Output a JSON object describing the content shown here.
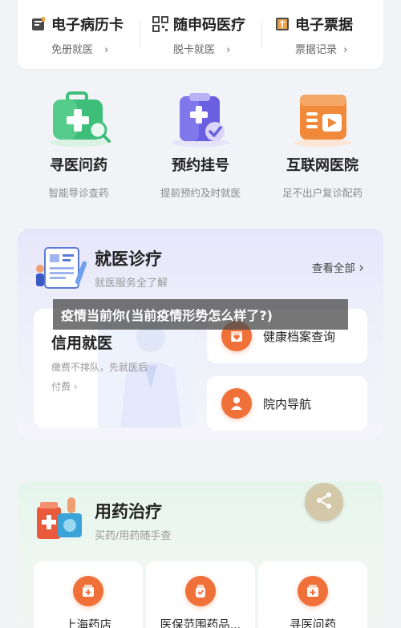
{
  "top_services": [
    {
      "title": "电子病历卡",
      "sub": "免册就医",
      "arrow": "›",
      "icon": "card-icon"
    },
    {
      "title": "随申码医疗",
      "sub": "脱卡就医",
      "arrow": "›",
      "icon": "qr-code-icon"
    },
    {
      "title": "电子票据",
      "sub": "票据记录",
      "arrow": "›",
      "icon": "receipt-icon"
    }
  ],
  "quick_services": [
    {
      "title": "寻医问药",
      "sub": "智能导诊查药",
      "icon": "medical-kit-search-icon"
    },
    {
      "title": "预约挂号",
      "sub": "提前预约及时就医",
      "icon": "appointment-clipboard-icon"
    },
    {
      "title": "互联网医院",
      "sub": "足不出户复诊配药",
      "icon": "online-hospital-icon"
    }
  ],
  "medical_panel": {
    "title": "就医诊疗",
    "subtitle": "就医服务全了解",
    "more": "查看全部",
    "more_arrow": "›",
    "credit_card": {
      "title": "信用就医",
      "desc": "缴费不排队，先就医后",
      "pay": "付费 ›"
    },
    "items": [
      {
        "label": "健康档案查询",
        "icon": "health-record-icon"
      },
      {
        "label": "院内导航",
        "icon": "person-navigation-icon"
      }
    ]
  },
  "banner": "疫情当前你(当前疫情形势怎么样了?)",
  "medicine_panel": {
    "title": "用药治疗",
    "subtitle": "买药/用药随手查",
    "items": [
      {
        "label": "上海药店",
        "icon": "pharmacy-icon"
      },
      {
        "label": "医保范围药品...",
        "icon": "insured-drug-icon"
      },
      {
        "label": "寻医问药",
        "icon": "medicine-search-icon"
      }
    ]
  },
  "colors": {
    "accent": "#f0703a",
    "green": "#3dbf7a",
    "purple": "#6a5fe0",
    "orange": "#f08a3a",
    "page_bg": "#f2f3f7"
  }
}
